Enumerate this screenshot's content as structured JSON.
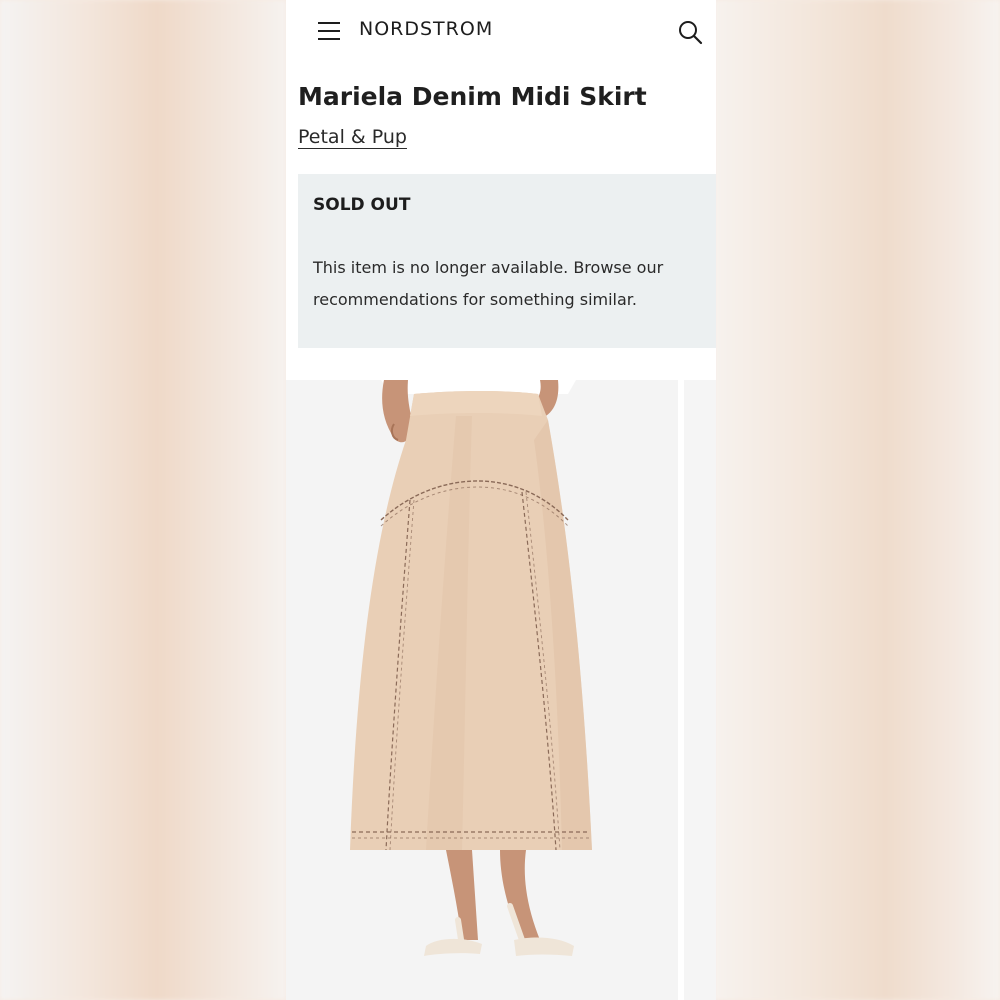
{
  "header": {
    "menu_icon": "hamburger-menu-icon",
    "brand": "NORDSTROM",
    "search_icon": "search-icon"
  },
  "product": {
    "title": "Mariela Denim Midi Skirt",
    "brand_name": "Petal & Pup"
  },
  "availability": {
    "status": "SOLD OUT",
    "message": "This item is no longer available. Browse our recommendations for something similar."
  },
  "colors": {
    "notice_background": "#ecf0f1",
    "skirt": "#e8cdb3",
    "stitching": "#8a6a58",
    "text": "#1d1d1d"
  }
}
